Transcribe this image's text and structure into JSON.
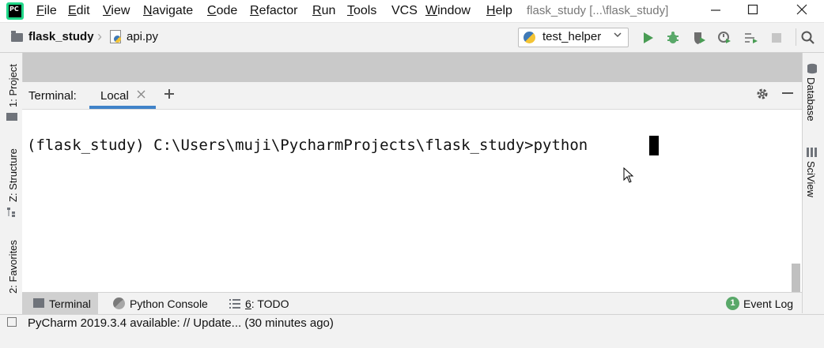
{
  "menu": {
    "items": [
      {
        "underline": "F",
        "rest": "ile"
      },
      {
        "underline": "E",
        "rest": "dit"
      },
      {
        "underline": "V",
        "rest": "iew"
      },
      {
        "underline": "N",
        "rest": "avigate"
      },
      {
        "underline": "C",
        "rest": "ode"
      },
      {
        "underline": "R",
        "rest": "efactor"
      },
      {
        "underline": "R",
        "rest": "un"
      },
      {
        "underline": "T",
        "rest": "ools"
      },
      {
        "underline": "",
        "rest": "VCS"
      },
      {
        "underline": "W",
        "rest": "indow"
      },
      {
        "underline": "H",
        "rest": "elp"
      }
    ]
  },
  "window": {
    "title": "flask_study [...\\flask_study]",
    "app_icon_text": "PC"
  },
  "breadcrumb": {
    "project": "flask_study",
    "file": "api.py"
  },
  "run_config": {
    "label": "test_helper"
  },
  "terminal": {
    "title": "Terminal:",
    "tab_label": "Local",
    "prompt": "(flask_study) C:\\Users\\muji\\PycharmProjects\\flask_study>python "
  },
  "left_panels": {
    "project": "1: Project",
    "structure": "Z: Structure",
    "favorites": "2: Favorites"
  },
  "right_panels": {
    "database": "Database",
    "sciview": "SciView"
  },
  "bottom_tools": {
    "terminal": "Terminal",
    "python_console": "Python Console",
    "todo_num": "6",
    "todo_rest": ": TODO",
    "event_log": "Event Log",
    "event_count": "1"
  },
  "status": {
    "text": "PyCharm 2019.3.4 available: // Update... (30 minutes ago)"
  },
  "colors": {
    "accent": "#4083c9",
    "run_green": "#499c54",
    "debug_green": "#59a869",
    "event_green": "#59a869"
  }
}
